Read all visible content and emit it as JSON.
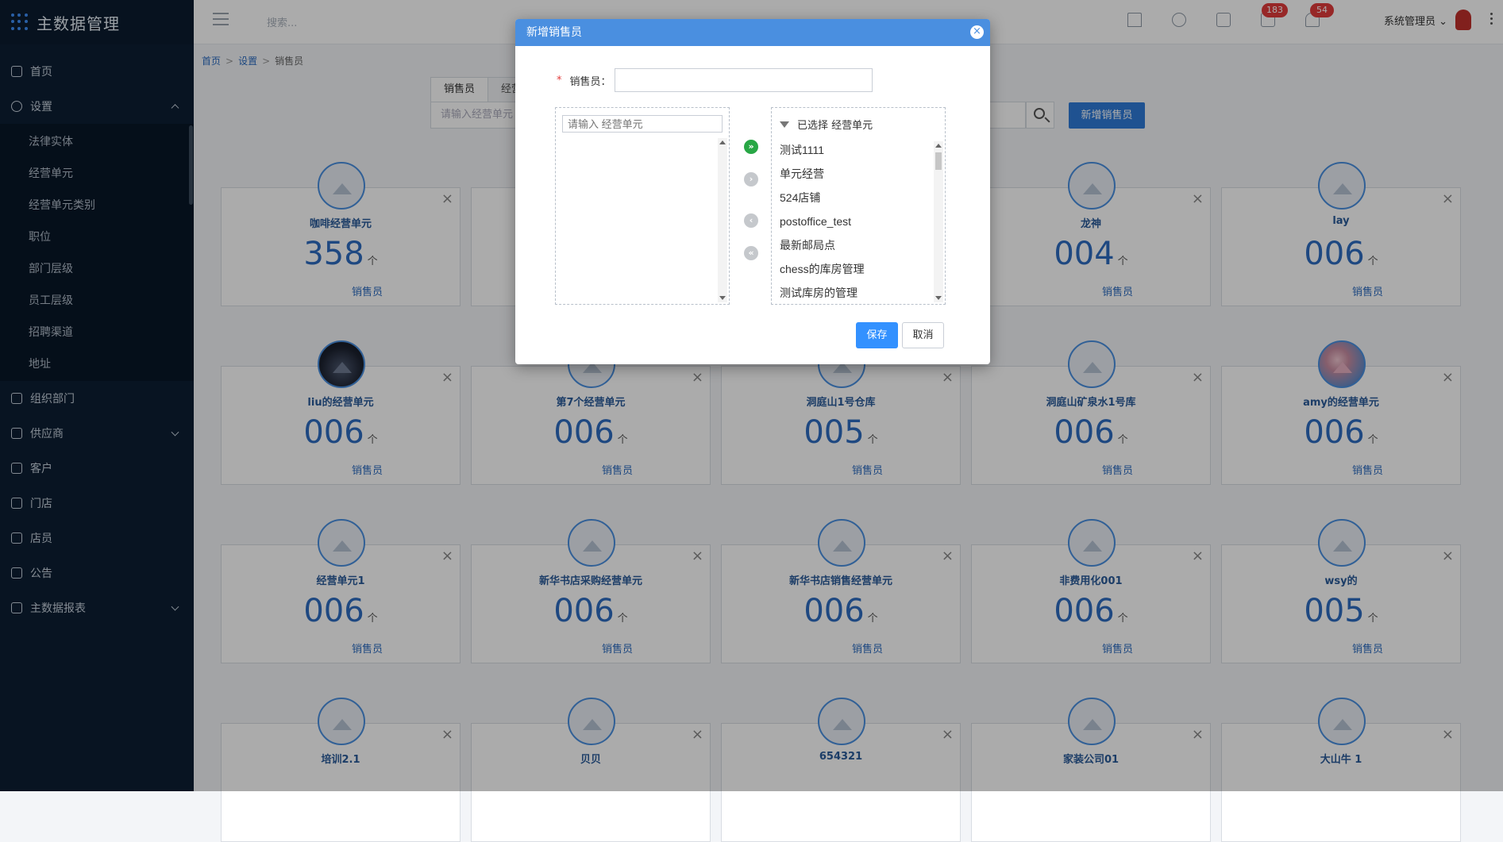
{
  "app": {
    "title": "主数据管理"
  },
  "sidebar": {
    "items": [
      {
        "label": "首页",
        "icon": "home-icon"
      },
      {
        "label": "设置",
        "icon": "gear-icon",
        "expanded": true,
        "children": [
          "法律实体",
          "经营单元",
          "经营单元类别",
          "职位",
          "部门层级",
          "员工层级",
          "招聘渠道",
          "地址"
        ]
      },
      {
        "label": "组织部门",
        "icon": "org-icon"
      },
      {
        "label": "供应商",
        "icon": "supplier-icon",
        "collapsible": true
      },
      {
        "label": "客户",
        "icon": "customer-icon"
      },
      {
        "label": "门店",
        "icon": "store-icon"
      },
      {
        "label": "店员",
        "icon": "clerk-icon"
      },
      {
        "label": "公告",
        "icon": "announcement-icon"
      },
      {
        "label": "主数据报表",
        "icon": "chart-icon",
        "collapsible": true
      }
    ]
  },
  "topbar": {
    "search_placeholder": "搜索...",
    "badge_messages": "183",
    "badge_notifications": "54",
    "user_name": "系统管理员"
  },
  "breadcrumb": {
    "home": "首页",
    "settings": "设置",
    "current": "销售员"
  },
  "tabs": [
    "销售员",
    "经营"
  ],
  "filter": {
    "placeholder": "请输入经营单元"
  },
  "add_button": "新增销售员",
  "cards": [
    {
      "name": "咖啡经营单元",
      "count": "358",
      "unit": "个",
      "role": "销售员",
      "avatar": "default"
    },
    {
      "name": "",
      "count": "",
      "unit": "",
      "role": "",
      "avatar": "default"
    },
    {
      "name": "",
      "count": "",
      "unit": "",
      "role": "",
      "avatar": "default"
    },
    {
      "name": "龙神",
      "count": "004",
      "unit": "个",
      "role": "销售员",
      "avatar": "default"
    },
    {
      "name": "lay",
      "count": "006",
      "unit": "个",
      "role": "销售员",
      "avatar": "default"
    },
    {
      "name": "liu的经营单元",
      "count": "006",
      "unit": "个",
      "role": "销售员",
      "avatar": "dark"
    },
    {
      "name": "第7个经营单元",
      "count": "006",
      "unit": "个",
      "role": "销售员",
      "avatar": "default"
    },
    {
      "name": "洞庭山1号仓库",
      "count": "005",
      "unit": "个",
      "role": "销售员",
      "avatar": "default"
    },
    {
      "name": "洞庭山矿泉水1号库",
      "count": "006",
      "unit": "个",
      "role": "销售员",
      "avatar": "default"
    },
    {
      "name": "amy的经营单元",
      "count": "006",
      "unit": "个",
      "role": "销售员",
      "avatar": "blossom"
    },
    {
      "name": "经营单元1",
      "count": "006",
      "unit": "个",
      "role": "销售员",
      "avatar": "default"
    },
    {
      "name": "新华书店采购经营单元",
      "count": "006",
      "unit": "个",
      "role": "销售员",
      "avatar": "default"
    },
    {
      "name": "新华书店销售经营单元",
      "count": "006",
      "unit": "个",
      "role": "销售员",
      "avatar": "default"
    },
    {
      "name": "非费用化001",
      "count": "006",
      "unit": "个",
      "role": "销售员",
      "avatar": "default"
    },
    {
      "name": "wsy的",
      "count": "005",
      "unit": "个",
      "role": "销售员",
      "avatar": "default"
    },
    {
      "name": "培训2.1",
      "count": "",
      "unit": "",
      "role": "",
      "avatar": "default"
    },
    {
      "name": "贝贝",
      "count": "",
      "unit": "",
      "role": "",
      "avatar": "default"
    },
    {
      "name": "654321",
      "count": "",
      "unit": "",
      "role": "",
      "avatar": "default"
    },
    {
      "name": "家装公司01",
      "count": "",
      "unit": "",
      "role": "",
      "avatar": "default"
    },
    {
      "name": "大山牛 1",
      "count": "",
      "unit": "",
      "role": "",
      "avatar": "default"
    }
  ],
  "modal": {
    "title": "新增销售员",
    "field_label": "销售员：",
    "field_required_mark": "*",
    "field_value": "",
    "left_panel": {
      "search_placeholder": "请输入 经营单元"
    },
    "right_panel": {
      "header": "已选择 经营单元",
      "items": [
        "测试1111",
        "单元经营",
        "524店铺",
        "postoffice_test",
        "最新邮局点",
        "chess的库房管理",
        "测试库房的管理"
      ]
    },
    "save_label": "保存",
    "cancel_label": "取消",
    "colors": {
      "header": "#4a8fe0",
      "save": "#3391ff",
      "move_all_right": "#28a745"
    }
  }
}
